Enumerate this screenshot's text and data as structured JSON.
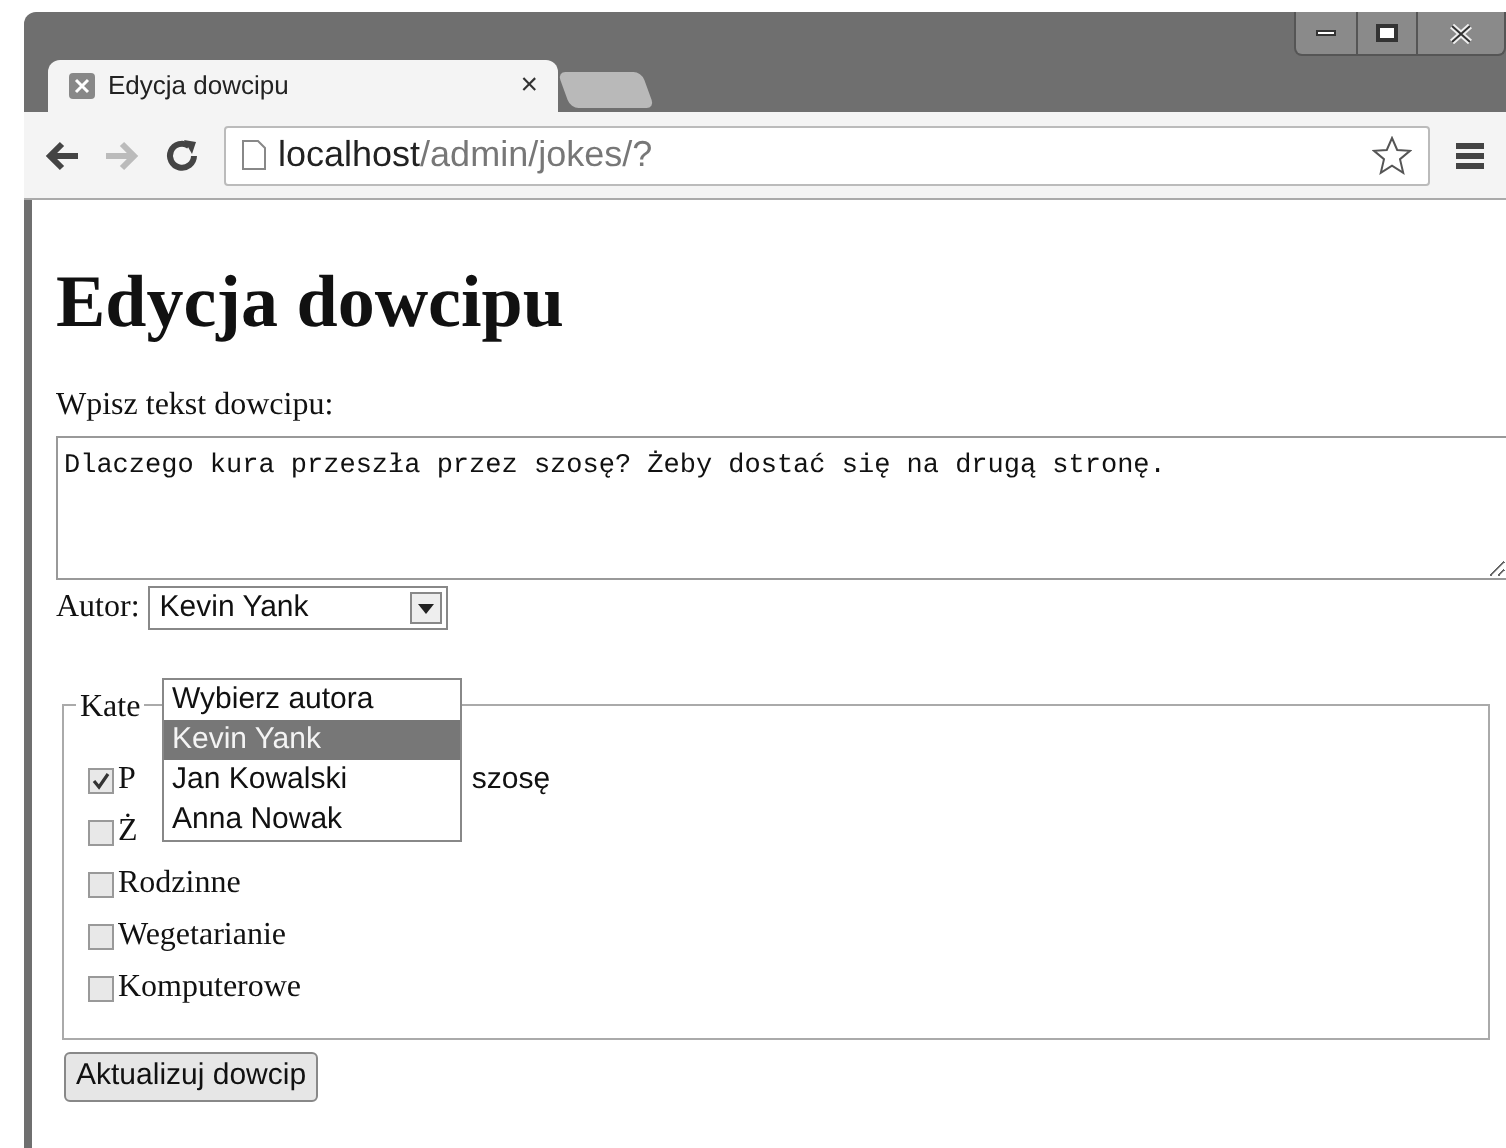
{
  "browser": {
    "tab": {
      "title": "Edycja dowcipu",
      "close": "×"
    },
    "address": {
      "host": "localhost",
      "path": "/admin/jokes/?"
    }
  },
  "page": {
    "heading": "Edycja dowcipu",
    "text_label": "Wpisz tekst dowcipu:",
    "joke_text": "Dlaczego kura przeszła przez szosę? Żeby dostać się na drugą stronę.",
    "author_label": "Autor:",
    "author_value": "Kevin Yank",
    "author_options": [
      {
        "label": "Wybierz autora",
        "selected": false
      },
      {
        "label": "Kevin Yank",
        "selected": true
      },
      {
        "label": "Jan Kowalski",
        "selected": false
      },
      {
        "label": "Anna Nowak",
        "selected": false
      }
    ],
    "categories_legend": "Kate",
    "categories": [
      {
        "label": "P",
        "tail": "szosę",
        "checked": true
      },
      {
        "label": "Ż",
        "checked": false
      },
      {
        "label": "Rodzinne",
        "checked": false
      },
      {
        "label": "Wegetarianie",
        "checked": false
      },
      {
        "label": "Komputerowe",
        "checked": false
      }
    ],
    "submit": "Aktualizuj dowcip"
  }
}
